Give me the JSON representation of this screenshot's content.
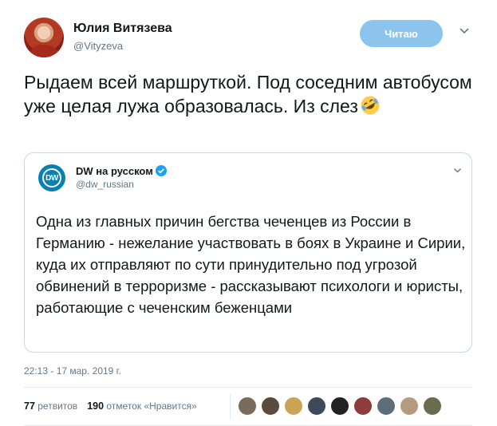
{
  "author": {
    "name": "Юлия Витязева",
    "handle": "@Vityzeva"
  },
  "follow_button": {
    "label": "Читаю"
  },
  "tweet": {
    "text": "Рыдаем всей маршруткой. Под соседним автобусом уже целая лужа образовалась. Из слез",
    "emoji_icon": "rolling-on-floor-laughing-emoji"
  },
  "quote": {
    "avatar_text": "DW",
    "name": "DW на русском",
    "handle": "@dw_russian",
    "text": "Одна из главных причин бегства чеченцев из России в Германию - нежелание участвовать в боях в Украине и Сирии, куда их отправляют по сути принудительно под угрозой обвинений в терроризме - рассказывают психологи и юристы, работающие с чеченским беженцами"
  },
  "timestamp": "22:13 - 17 мар. 2019 г.",
  "stats": {
    "retweets_count": "77",
    "retweets_label": "ретвитов",
    "likes_count": "190",
    "likes_label": "отметок «Нравится»"
  },
  "likers": [
    {
      "color": "#7a6a5a"
    },
    {
      "color": "#5b4b3f"
    },
    {
      "color": "#c9a455"
    },
    {
      "color": "#3d4a58"
    },
    {
      "color": "#222222"
    },
    {
      "color": "#8d3b3b"
    },
    {
      "color": "#5e6d7a"
    },
    {
      "color": "#b69a80"
    },
    {
      "color": "#6b6b4e"
    }
  ],
  "colors": {
    "follow_button": "#8cc4ee",
    "verified": "#1da1f2",
    "dw_blue": "#0a7fb4"
  }
}
